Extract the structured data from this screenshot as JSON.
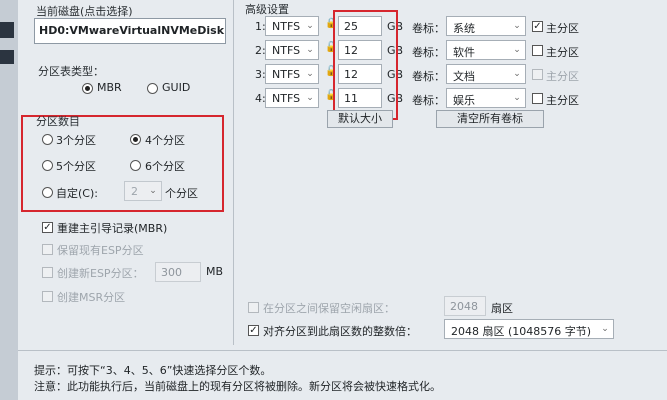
{
  "current_disk": {
    "label": "当前磁盘(点击选择)",
    "value": "HD0:VMwareVirtualNVMeDisk"
  },
  "partition_table": {
    "label": "分区表类型：",
    "options": [
      "MBR",
      "GUID"
    ],
    "selected": "MBR"
  },
  "partition_count": {
    "label": "分区数目",
    "options": [
      "3个分区",
      "4个分区",
      "5个分区",
      "6个分区"
    ],
    "selected": "4个分区",
    "custom_label": "自定(C):",
    "custom_value": "2",
    "custom_unit": "个分区"
  },
  "options": {
    "rebuild_mbr": "重建主引导记录(MBR)",
    "keep_esp": "保留现有ESP分区",
    "create_esp": "创建新ESP分区：",
    "esp_size": "300",
    "esp_unit": "MB",
    "create_msr": "创建MSR分区"
  },
  "advanced": {
    "label": "高级设置",
    "gb_unit": "GB",
    "volume_label_text": "卷标：",
    "primary_text": "主分区",
    "rows": [
      {
        "index": "1:",
        "fs": "NTFS",
        "size": "25",
        "label": "系统",
        "primary": true
      },
      {
        "index": "2:",
        "fs": "NTFS",
        "size": "12",
        "label": "软件",
        "primary": false
      },
      {
        "index": "3:",
        "fs": "NTFS",
        "size": "12",
        "label": "文档",
        "primary": false
      },
      {
        "index": "4:",
        "fs": "NTFS",
        "size": "11",
        "label": "娱乐",
        "primary": false
      }
    ],
    "default_size_button": "默认大小",
    "clear_labels_button": "清空所有卷标"
  },
  "alignment": {
    "reserve_label": "在分区之间保留空闲扇区：",
    "reserve_value": "2048",
    "reserve_unit": "扇区",
    "align_label": "对齐分区到此扇区数的整数倍：",
    "align_value": "2048 扇区 (1048576 字节)"
  },
  "footer": {
    "tip": "提示：可按下“3、4、5、6”快速选择分区个数。",
    "note": "注意：此功能执行后，当前磁盘上的现有分区将被删除。新分区将会被快速格式化。"
  },
  "colors": {
    "annotation": "#d6262e",
    "panel_bg": "#e7ebef"
  }
}
